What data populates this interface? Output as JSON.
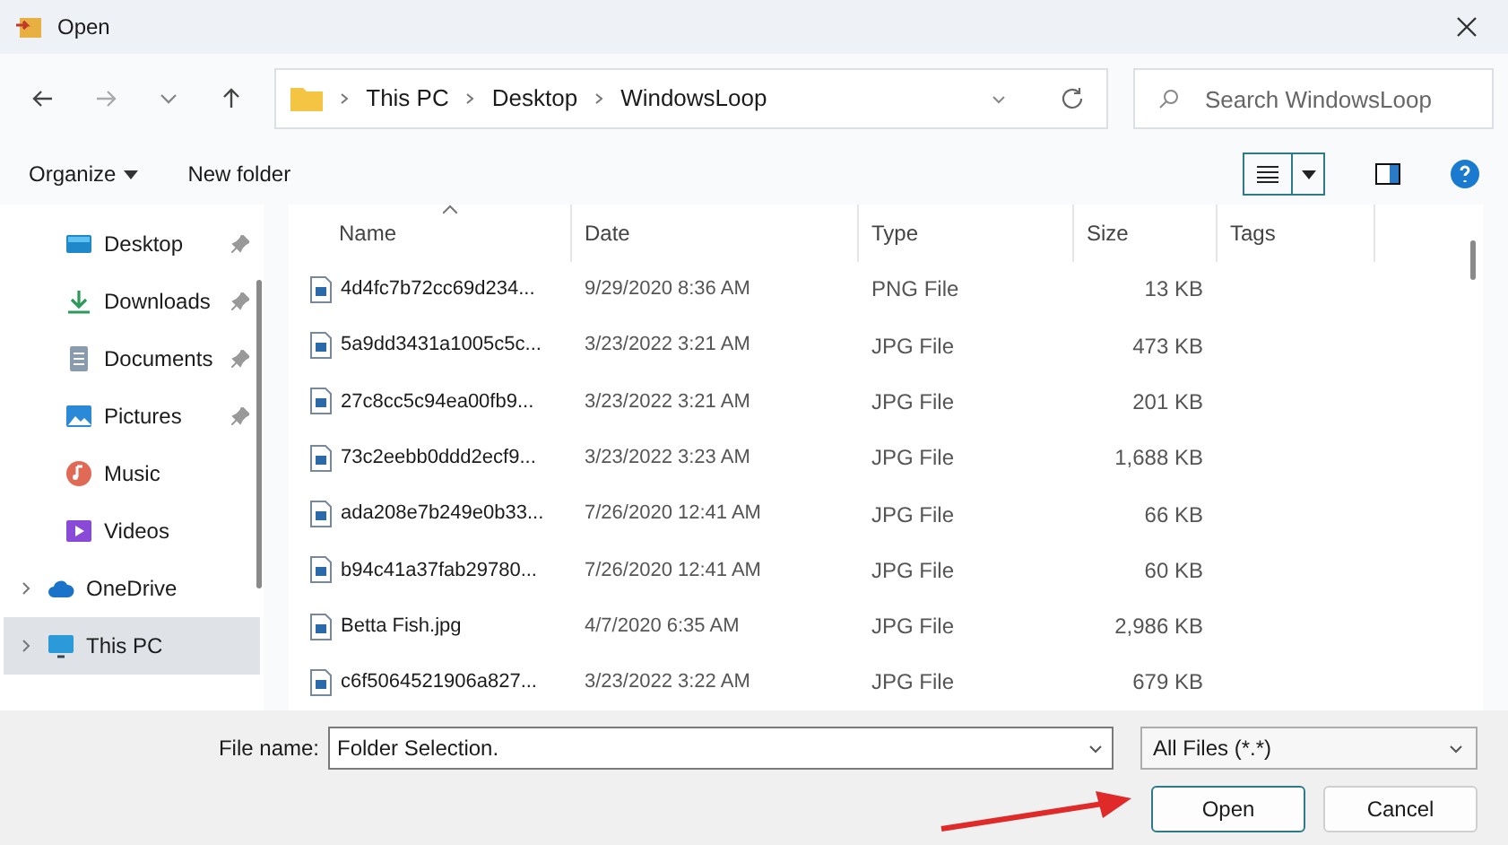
{
  "window": {
    "title": "Open"
  },
  "address": {
    "crumbs": [
      "This PC",
      "Desktop",
      "WindowsLoop"
    ]
  },
  "search": {
    "placeholder": "Search WindowsLoop"
  },
  "toolbar": {
    "organize": "Organize",
    "new_folder": "New folder"
  },
  "sidebar": {
    "items": [
      {
        "label": "Desktop",
        "kind": "desktop",
        "pinned": true,
        "expandable": false,
        "selected": false
      },
      {
        "label": "Downloads",
        "kind": "downloads",
        "pinned": true,
        "expandable": false,
        "selected": false
      },
      {
        "label": "Documents",
        "kind": "documents",
        "pinned": true,
        "expandable": false,
        "selected": false
      },
      {
        "label": "Pictures",
        "kind": "pictures",
        "pinned": true,
        "expandable": false,
        "selected": false
      },
      {
        "label": "Music",
        "kind": "music",
        "pinned": false,
        "expandable": false,
        "selected": false
      },
      {
        "label": "Videos",
        "kind": "videos",
        "pinned": false,
        "expandable": false,
        "selected": false
      },
      {
        "label": "OneDrive",
        "kind": "cloud",
        "pinned": false,
        "expandable": true,
        "selected": false
      },
      {
        "label": "This PC",
        "kind": "computer",
        "pinned": false,
        "expandable": true,
        "selected": true
      }
    ]
  },
  "table": {
    "columns": [
      "Name",
      "Date",
      "Type",
      "Size",
      "Tags"
    ],
    "rows": [
      [
        "4d4fc7b72cc69d234...",
        "9/29/2020 8:36 AM",
        "PNG File",
        "13 KB"
      ],
      [
        "5a9dd3431a1005c5c...",
        "3/23/2022 3:21 AM",
        "JPG File",
        "473 KB"
      ],
      [
        "27c8cc5c94ea00fb9...",
        "3/23/2022 3:21 AM",
        "JPG File",
        "201 KB"
      ],
      [
        "73c2eebb0ddd2ecf9...",
        "3/23/2022 3:23 AM",
        "JPG File",
        "1,688 KB"
      ],
      [
        "ada208e7b249e0b33...",
        "7/26/2020 12:41 AM",
        "JPG File",
        "66 KB"
      ],
      [
        "b94c41a37fab29780...",
        "7/26/2020 12:41 AM",
        "JPG File",
        "60 KB"
      ],
      [
        "Betta Fish.jpg",
        "4/7/2020 6:35 AM",
        "JPG File",
        "2,986 KB"
      ],
      [
        "c6f5064521906a827...",
        "3/23/2022 3:22 AM",
        "JPG File",
        "679 KB"
      ]
    ]
  },
  "file_name": {
    "label": "File name:",
    "value": "Folder Selection."
  },
  "file_type": {
    "value": "All Files (*.*)"
  },
  "buttons": [
    "Open",
    "Cancel"
  ]
}
